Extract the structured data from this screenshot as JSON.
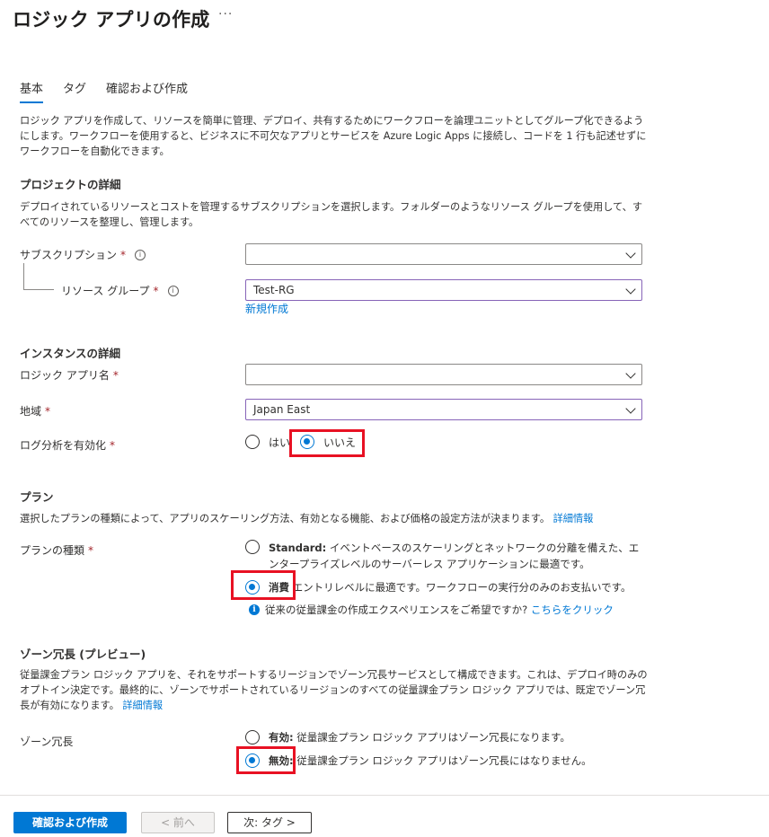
{
  "page": {
    "title": "ロジック アプリの作成",
    "more": "···"
  },
  "tabs": [
    {
      "label": "基本"
    },
    {
      "label": "タグ"
    },
    {
      "label": "確認および作成"
    }
  ],
  "intro": "ロジック アプリを作成して、リソースを簡単に管理、デプロイ、共有するためにワークフローを論理ユニットとしてグループ化できるようにします。ワークフローを使用すると、ビジネスに不可欠なアプリとサービスを Azure Logic Apps に接続し、コードを 1 行も記述せずにワークフローを自動化できます。",
  "project": {
    "heading": "プロジェクトの詳細",
    "description": "デプロイされているリソースとコストを管理するサブスクリプションを選択します。フォルダーのようなリソース グループを使用して、すべてのリソースを整理し、管理します。",
    "subscription_label": "サブスクリプション",
    "subscription_value": "",
    "resource_group_label": "リソース グループ",
    "resource_group_value": "Test-RG",
    "new_link": "新規作成"
  },
  "instance": {
    "heading": "インスタンスの詳細",
    "name_label": "ロジック アプリ名",
    "name_value": "",
    "region_label": "地域",
    "region_value": "Japan East",
    "log_label": "ログ分析を有効化",
    "log_yes": "はい",
    "log_no": "いいえ"
  },
  "plan": {
    "heading": "プラン",
    "description": "選択したプランの種類によって、アプリのスケーリング方法、有効となる機能、および価格の設定方法が決まります。",
    "learn_more": "詳細情報",
    "type_label": "プランの種類",
    "standard_title": "Standard:",
    "standard_desc": "イベントベースのスケーリングとネットワークの分離を備えた、エンタープライズレベルのサーバーレス アプリケーションに最適です。",
    "consumption_title": "消費",
    "consumption_desc": "エントリレベルに最適です。ワークフローの実行分のみのお支払いです。",
    "note_text": "従来の従量課金の作成エクスペリエンスをご希望ですか?",
    "note_link": "こちらをクリック"
  },
  "zone": {
    "heading": "ゾーン冗長 (プレビュー)",
    "description": "従量課金プラン ロジック アプリを、それをサポートするリージョンでゾーン冗長サービスとして構成できます。これは、デプロイ時のみのオプトイン決定です。最終的に、ゾーンでサポートされているリージョンのすべての従量課金プラン ロジック アプリでは、既定でゾーン冗長が有効になります。",
    "learn_more": "詳細情報",
    "label": "ゾーン冗長",
    "enabled_title": "有効:",
    "enabled_desc": "従量課金プラン ロジック アプリはゾーン冗長になります。",
    "disabled_title": "無効:",
    "disabled_desc": "従量課金プラン ロジック アプリはゾーン冗長にはなりません。"
  },
  "footer": {
    "review_button": "確認および作成",
    "prev_button": "< 前へ",
    "next_button": "次: タグ >"
  },
  "colors": {
    "accent": "#0078d4",
    "highlight": "#e81123"
  }
}
